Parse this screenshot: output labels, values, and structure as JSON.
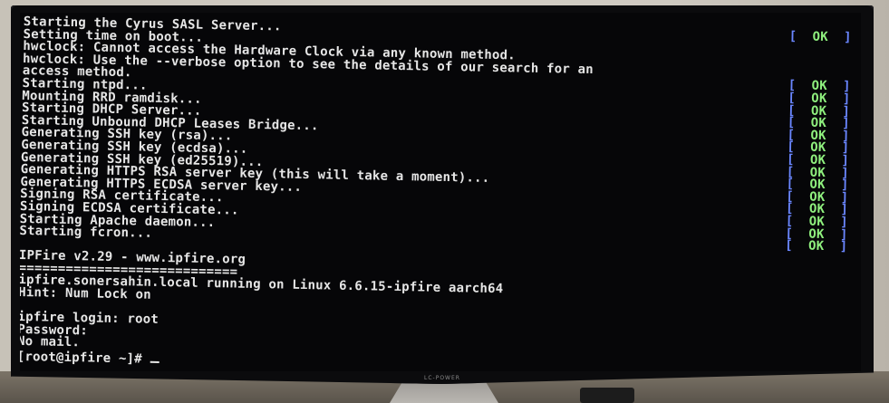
{
  "monitor": {
    "brand": "LC-POWER"
  },
  "status_colors": {
    "bracket": "#6a86ff",
    "ok": "#8ff07e",
    "text": "#e6e6e6"
  },
  "boot_lines": [
    {
      "text": "Starting the Cyrus SASL Server...",
      "status": "OK"
    },
    {
      "text": "Setting time on boot...",
      "status": ""
    },
    {
      "text": "hwclock: Cannot access the Hardware Clock via any known method.",
      "status": ""
    },
    {
      "text": "hwclock: Use the --verbose option to see the details of our search for an",
      "status": ""
    },
    {
      "text": "access method.",
      "status": "OK"
    },
    {
      "text": "Starting ntpd...",
      "status": "OK"
    },
    {
      "text": "Mounting RRD ramdisk...",
      "status": "OK"
    },
    {
      "text": "Starting DHCP Server...",
      "status": "OK"
    },
    {
      "text": "Starting Unbound DHCP Leases Bridge...",
      "status": "OK"
    },
    {
      "text": "Generating SSH key (rsa)...",
      "status": "OK"
    },
    {
      "text": "Generating SSH key (ecdsa)...",
      "status": "OK"
    },
    {
      "text": "Generating SSH key (ed25519)...",
      "status": "OK"
    },
    {
      "text": "Generating HTTPS RSA server key (this will take a moment)...",
      "status": "OK"
    },
    {
      "text": "Generating HTTPS ECDSA server key...",
      "status": "OK"
    },
    {
      "text": "Signing RSA certificate...",
      "status": "OK"
    },
    {
      "text": "Signing ECDSA certificate...",
      "status": "OK"
    },
    {
      "text": "Starting Apache daemon...",
      "status": "OK"
    },
    {
      "text": "Starting fcron...",
      "status": "OK"
    }
  ],
  "banner": {
    "title": "IPFire v2.29 - www.ipfire.org",
    "underline": "============================",
    "host_line": "ipfire.sonersahin.local running on Linux 6.6.15-ipfire aarch64",
    "hint": "Hint: Num Lock on"
  },
  "login": {
    "login_line": "ipfire login: root",
    "password_line": "Password:",
    "mail_line": "No mail.",
    "prompt": "[root@ipfire ~]# "
  }
}
